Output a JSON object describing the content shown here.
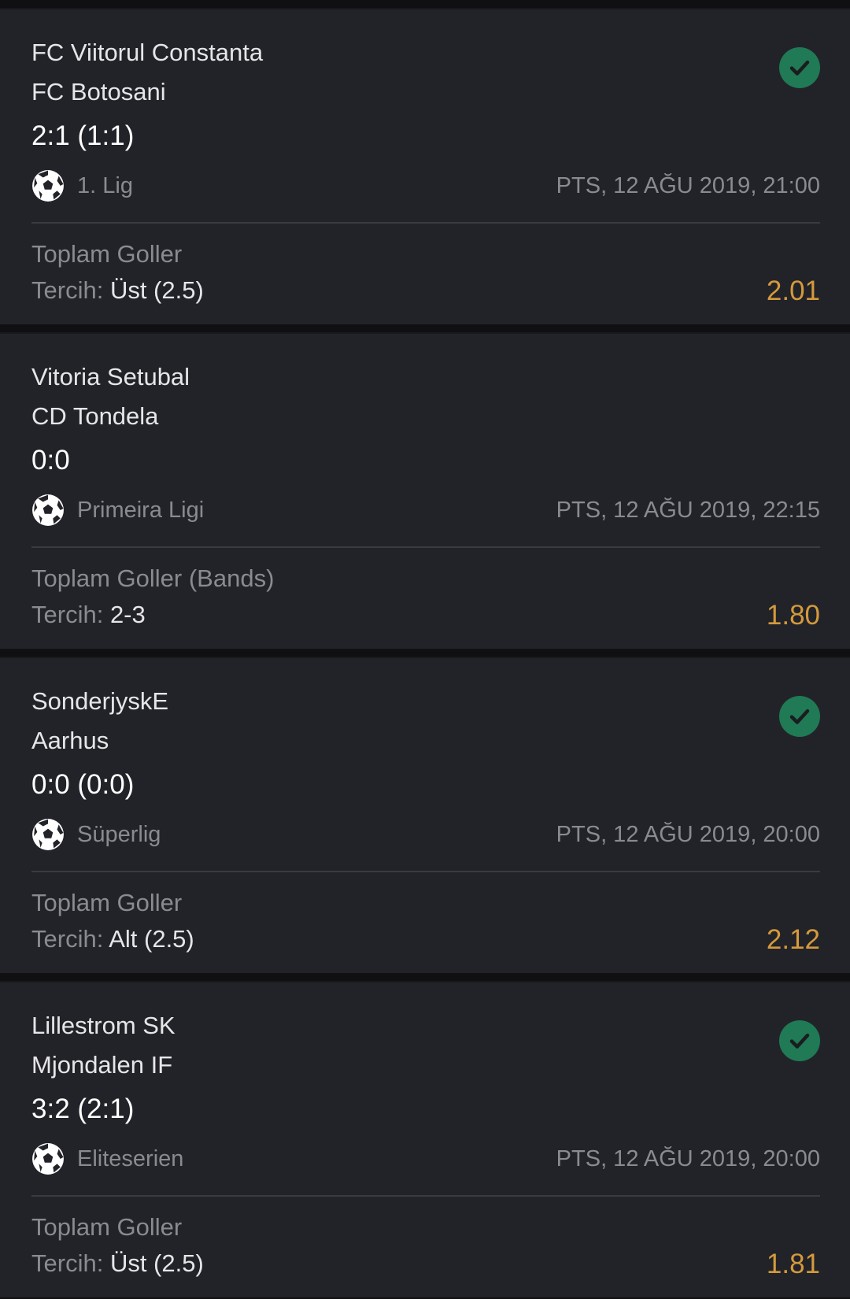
{
  "colors": {
    "card_background": "#222328",
    "page_background": "#101012",
    "odds": "#d49a3c",
    "won_badge": "#1f7a55",
    "muted_text": "#8a8b90"
  },
  "pick_label": "Tercih:",
  "bets": [
    {
      "home_team": "FC Viitorul Constanta",
      "away_team": "FC Botosani",
      "score": "2:1 (1:1)",
      "league": "1. Lig",
      "sport_icon": "soccer-ball-icon",
      "datetime": "PTS, 12 AĞU 2019, 21:00",
      "market": "Toplam Goller",
      "pick": "Üst (2.5)",
      "odds": "2.01",
      "won": true
    },
    {
      "home_team": "Vitoria Setubal",
      "away_team": "CD Tondela",
      "score": "0:0",
      "league": "Primeira Ligi",
      "sport_icon": "soccer-ball-icon",
      "datetime": "PTS, 12 AĞU 2019, 22:15",
      "market": "Toplam Goller (Bands)",
      "pick": "2-3",
      "odds": "1.80",
      "won": false
    },
    {
      "home_team": "SonderjyskE",
      "away_team": "Aarhus",
      "score": "0:0 (0:0)",
      "league": "Süperlig",
      "sport_icon": "soccer-ball-icon",
      "datetime": "PTS, 12 AĞU 2019, 20:00",
      "market": "Toplam Goller",
      "pick": "Alt (2.5)",
      "odds": "2.12",
      "won": true
    },
    {
      "home_team": "Lillestrom SK",
      "away_team": "Mjondalen IF",
      "score": "3:2 (2:1)",
      "league": "Eliteserien",
      "sport_icon": "soccer-ball-icon",
      "datetime": "PTS, 12 AĞU 2019, 20:00",
      "market": "Toplam Goller",
      "pick": "Üst (2.5)",
      "odds": "1.81",
      "won": true
    }
  ]
}
